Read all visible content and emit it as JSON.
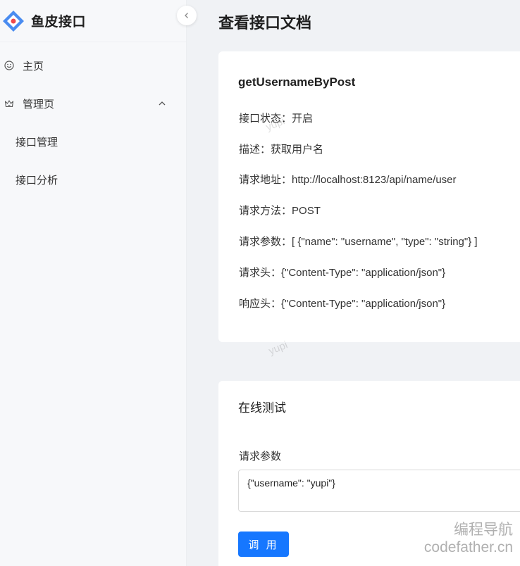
{
  "app": {
    "title": "鱼皮接口"
  },
  "sidebar": {
    "collapse_icon": "chevron-left-icon",
    "items": [
      {
        "label": "主页",
        "icon": "smile-icon"
      },
      {
        "label": "管理页",
        "icon": "crown-icon",
        "expanded": true,
        "children": [
          {
            "label": "接口管理"
          },
          {
            "label": "接口分析"
          }
        ]
      }
    ]
  },
  "page": {
    "title": "查看接口文档"
  },
  "doc": {
    "name": "getUsernameByPost",
    "fields": [
      {
        "label": "接口状态：",
        "value": "开启"
      },
      {
        "label": "描述：",
        "value": "获取用户名"
      },
      {
        "label": "请求地址：",
        "value": "http://localhost:8123/api/name/user"
      },
      {
        "label": "请求方法：",
        "value": "POST"
      },
      {
        "label": "请求参数：",
        "value": "[ {\"name\": \"username\", \"type\": \"string\"} ]"
      },
      {
        "label": "请求头：",
        "value": "{\"Content-Type\": \"application/json\"}"
      },
      {
        "label": "响应头：",
        "value": "{\"Content-Type\": \"application/json\"}"
      }
    ]
  },
  "test": {
    "title": "在线测试",
    "param_label": "请求参数",
    "param_value": "{\"username\": \"yupi\"}",
    "call_label": "调 用"
  },
  "watermarks": {
    "user": "yupi",
    "brand_cn": "编程导航",
    "brand_url": "codefather.cn"
  },
  "colors": {
    "primary": "#1677ff",
    "sidebar_bg": "#f7f8fa",
    "page_bg": "#f0f2f5"
  }
}
